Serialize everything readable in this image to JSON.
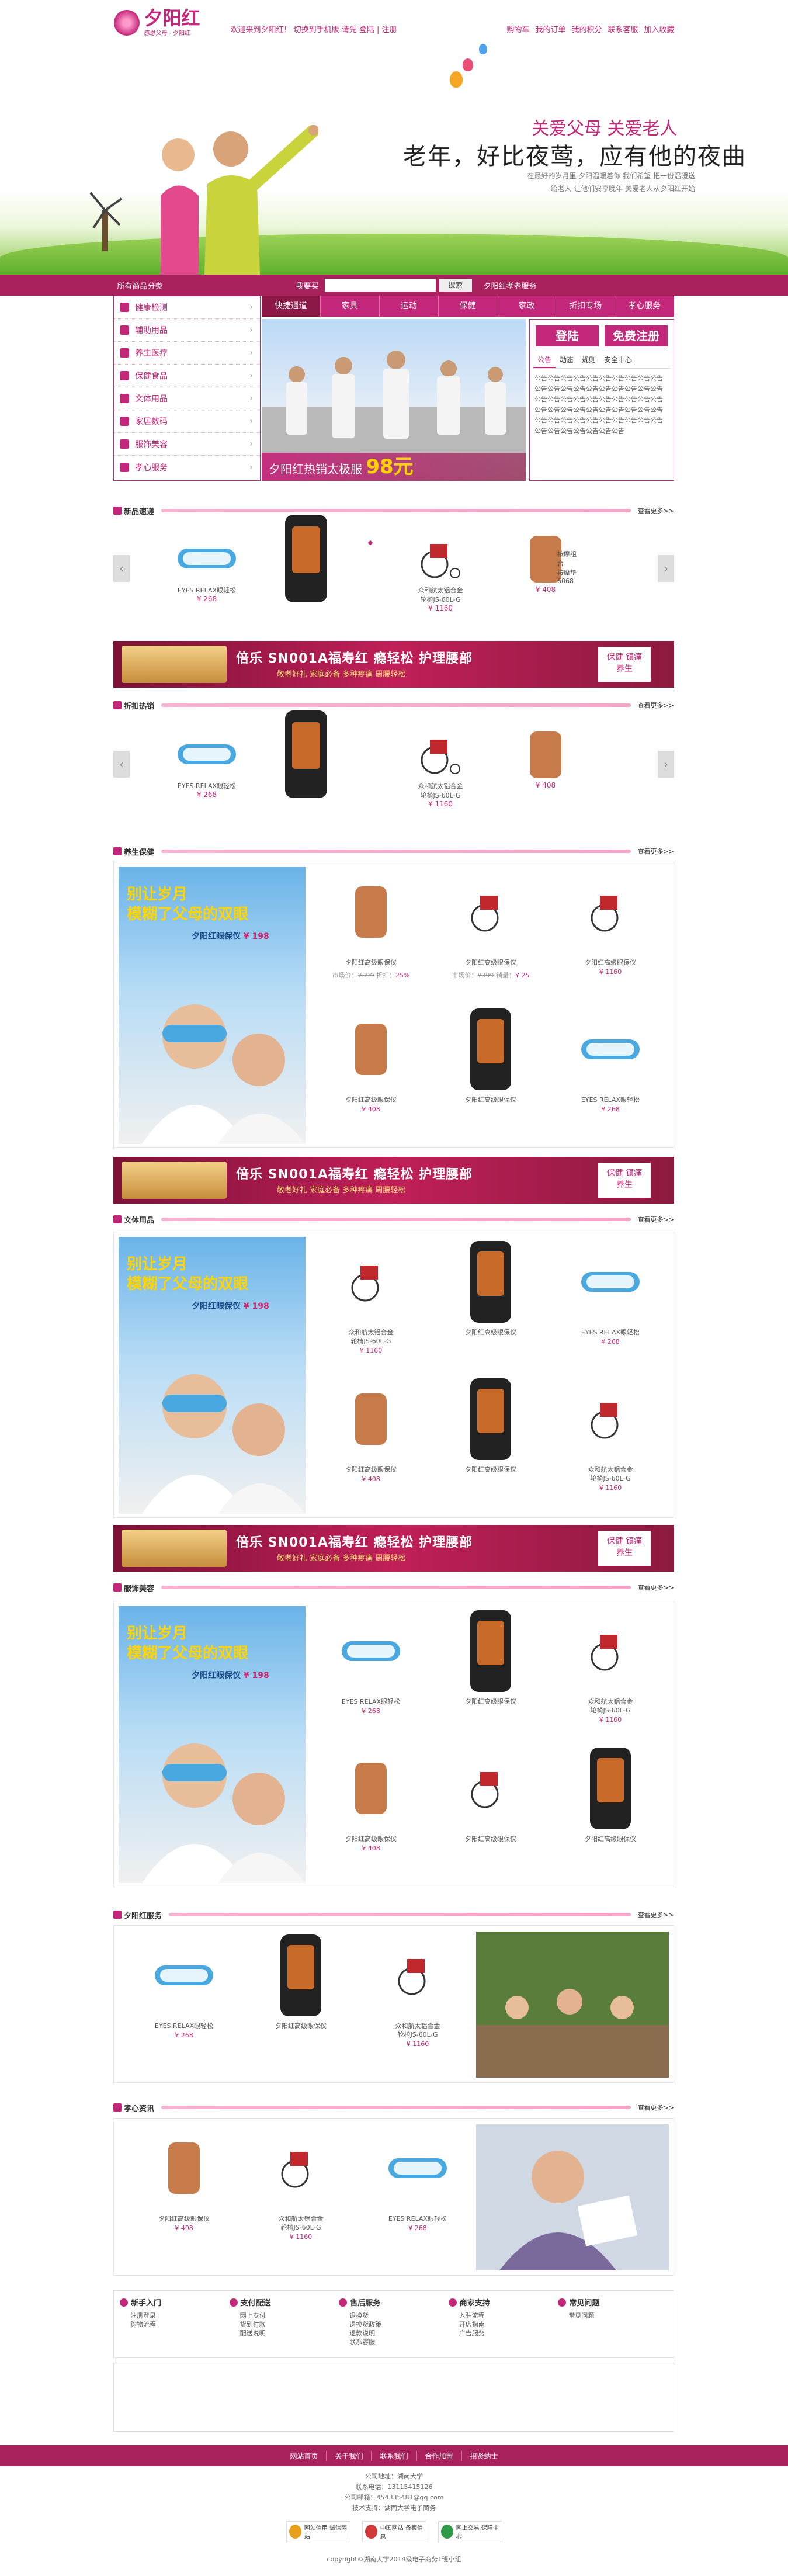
{
  "header": {
    "logo_text": "夕阳红",
    "logo_sub": "感恩父母 · 夕阳红",
    "welcome": "欢迎来到夕阳红！ 切换到手机版 请先 登陆 | 注册",
    "user_nav": [
      "购物车",
      "我的订单",
      "我的积分",
      "联系客服",
      "加入收藏"
    ]
  },
  "banner": {
    "slogan1": "关爱父母 关爱老人",
    "slogan2": "老年，好比夜莺，应有他的夜曲",
    "slogan3": "在最好的岁月里 夕阳温暖着你 我们希望 把一份温暖送给老人 让他们安享晚年 关爱老人从夕阳红开始"
  },
  "search": {
    "cats_label": "所有商品分类",
    "label": "我要买",
    "placeholder": "",
    "button": "搜索",
    "hot": "夕阳红孝老服务"
  },
  "sidebar": [
    {
      "label": "健康检测"
    },
    {
      "label": "辅助用品"
    },
    {
      "label": "养生医疗"
    },
    {
      "label": "保健食品"
    },
    {
      "label": "文体用品"
    },
    {
      "label": "家居数码"
    },
    {
      "label": "服饰美容"
    },
    {
      "label": "孝心服务"
    }
  ],
  "navtabs": [
    "快捷通道",
    "家具",
    "运动",
    "保健",
    "家政",
    "折扣专场",
    "孝心服务"
  ],
  "slide": {
    "caption": "夕阳红热销太极服",
    "price": "98元"
  },
  "login": {
    "login_btn": "登陆",
    "register_btn": "免费注册",
    "tabs": [
      "公告",
      "动态",
      "规则",
      "安全中心"
    ],
    "text": "公告公告公告公告公告公告公告公告公告公告公告公告公告公告公告公告公告公告公告公告公告公告公告公告公告公告公告公告公告公告公告公告公告公告公告公告公告公告公告公告公告公告公告公告公告公告公告公告公告公告公告公告公告公告公告公告公告"
  },
  "more": "查看更多>>",
  "sections": {
    "new": "新品速递",
    "hot": "折扣热销",
    "health": "养生保健",
    "culture": "文体用品",
    "fashion": "服饰美容",
    "service": "夕阳红服务",
    "filial": "孝心资讯"
  },
  "products": {
    "eyes": {
      "name": "EYES RELAX眼轻松",
      "price": "¥ 268"
    },
    "massager": {
      "name": "按摩组合\n按摩垫6068",
      "price": "¥ 408"
    },
    "wheelchair": {
      "name": "众和航太铝合金\n轮椅JS-60L-G",
      "price": "¥ 1160"
    },
    "seat": {
      "name": "",
      "price": ""
    }
  },
  "grid_meta": {
    "name": "夕阳红高级眼保仪",
    "orig": "市场价：",
    "orig_val": "¥399",
    "discount": "折扣：",
    "disc_val": "25%",
    "sold": "销量：",
    "sold_val": "¥ 25"
  },
  "poster": {
    "line1": "别让岁月",
    "line2": "模糊了父母的双眼",
    "brand": "夕阳红眼保仪",
    "price": "¥ 198"
  },
  "ad": {
    "text": "倍乐 SN001A福寿红 瘾轻松 护理腰部",
    "sub": "敬老好礼  家庭必备  多种疼痛  周腰轻松",
    "tag1": "保健",
    "tag2": "镇痛",
    "tag3": "养生",
    "tag4": "健康"
  },
  "help": [
    {
      "title": "新手入门",
      "items": [
        "注册登录",
        "购物流程"
      ]
    },
    {
      "title": "支付配送",
      "items": [
        "网上支付",
        "货到付款",
        "配送说明"
      ]
    },
    {
      "title": "售后服务",
      "items": [
        "退换货",
        "退换货政策",
        "退款说明",
        "联系客服"
      ]
    },
    {
      "title": "商家支持",
      "items": [
        "入驻流程",
        "开店指南",
        "广告服务"
      ]
    },
    {
      "title": "常见问题",
      "items": [
        "常见问题"
      ]
    }
  ],
  "footer": {
    "links": [
      "网站首页",
      "关于我们",
      "联系我们",
      "合作加盟",
      "招贤纳士"
    ],
    "info": [
      "公司地址：湖南大学",
      "联系电话：13115415126",
      "公司邮箱：454335481@qq.com",
      "技术支持：湖南大学电子商务"
    ],
    "copyright": "copyright©湖南大学2014级电子商务1班小组"
  },
  "badges": [
    "网站信用 诚信网站",
    "中国网站 备案信息",
    "网上交易 保障中心"
  ],
  "colors": {
    "brand": "#c3277a",
    "bar": "#a8205c"
  }
}
